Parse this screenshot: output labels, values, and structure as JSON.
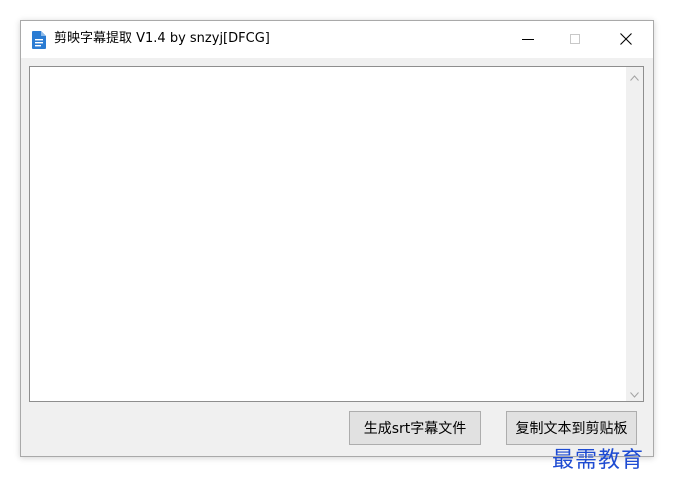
{
  "window": {
    "title": "剪映字幕提取 V1.4 by snzyj[DFCG]",
    "app_icon": "document-icon",
    "controls": {
      "minimize": "minimize-icon",
      "maximize": "maximize-icon",
      "close": "close-icon"
    }
  },
  "main": {
    "text_value": ""
  },
  "buttons": {
    "generate_srt": "生成srt字幕文件",
    "copy_to_clipboard": "复制文本到剪贴板"
  },
  "watermark": {
    "text": "最需教育"
  },
  "colors": {
    "app_icon": "#2b7cd3",
    "watermark": "#1e4bd2",
    "window_bg": "#f0f0f0",
    "button_bg": "#e1e1e1"
  }
}
